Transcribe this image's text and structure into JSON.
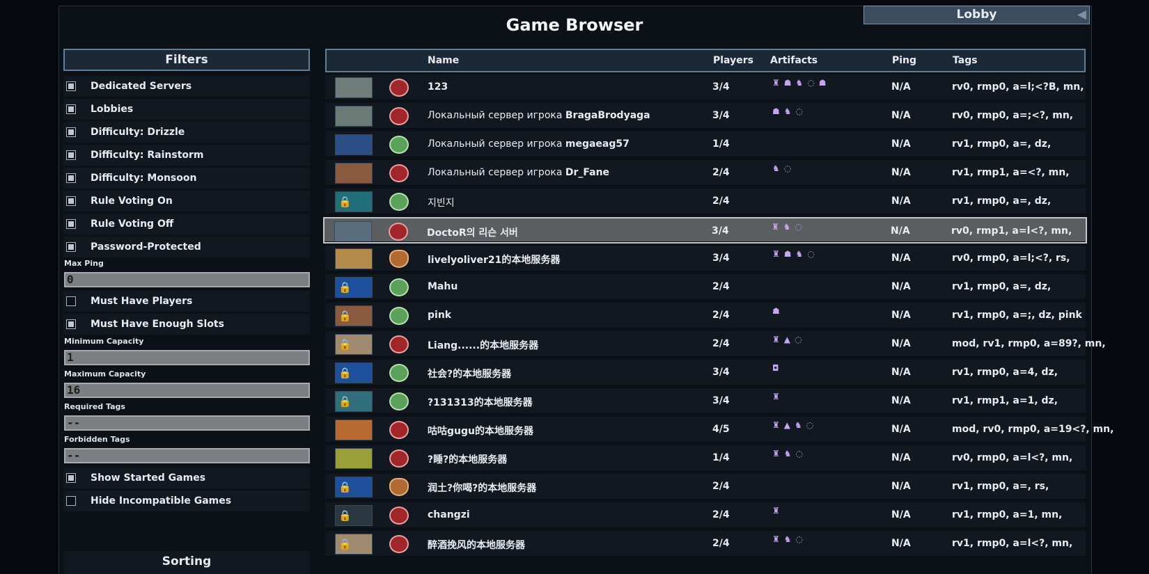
{
  "window": {
    "title": "Game Browser",
    "lobby_label": "Lobby"
  },
  "filters": {
    "title": "Filters",
    "checks_top": [
      {
        "label": "Dedicated Servers",
        "checked": true
      },
      {
        "label": "Lobbies",
        "checked": true
      },
      {
        "label": "Difficulty: Drizzle",
        "checked": true
      },
      {
        "label": "Difficulty: Rainstorm",
        "checked": true
      },
      {
        "label": "Difficulty: Monsoon",
        "checked": true
      },
      {
        "label": "Rule Voting On",
        "checked": true
      },
      {
        "label": "Rule Voting Off",
        "checked": true
      },
      {
        "label": "Password-Protected",
        "checked": true
      }
    ],
    "max_ping_label": "Max Ping",
    "max_ping_value": "0",
    "must_have_players": {
      "label": "Must Have Players",
      "checked": false
    },
    "must_have_slots": {
      "label": "Must Have Enough Slots",
      "checked": true
    },
    "min_capacity_label": "Minimum Capacity",
    "min_capacity_value": "1",
    "max_capacity_label": "Maximum Capacity",
    "max_capacity_value": "16",
    "required_tags_label": "Required Tags",
    "required_tags_value": "--",
    "forbidden_tags_label": "Forbidden Tags",
    "forbidden_tags_value": "--",
    "show_started": {
      "label": "Show Started Games",
      "checked": true
    },
    "hide_incompatible": {
      "label": "Hide Incompatible Games",
      "checked": false
    },
    "sorting_title": "Sorting"
  },
  "table": {
    "columns": {
      "name": "Name",
      "players": "Players",
      "artifacts": "Artifacts",
      "ping": "Ping",
      "tags": "Tags"
    },
    "rows": [
      {
        "name_prefix": "",
        "name_bold": "123",
        "players": "3/4",
        "artifacts": "♜☗♞◌☗",
        "ping": "N/A",
        "tags": "rv0, rmp0, a=l;<?B, mn,",
        "avatar": "red",
        "thumb": "#6f7e7a",
        "lock": false,
        "selected": false
      },
      {
        "name_prefix": "Локальный сервер игрока ",
        "name_bold": "BragaBrodyaga",
        "players": "3/4",
        "artifacts": "☗♞◌",
        "ping": "N/A",
        "tags": "rv0, rmp0, a=;<?, mn,",
        "avatar": "red",
        "thumb": "#6a7a74",
        "lock": false,
        "selected": false
      },
      {
        "name_prefix": "Локальный сервер игрока ",
        "name_bold": "megaeag57",
        "players": "1/4",
        "artifacts": "",
        "ping": "N/A",
        "tags": "rv1, rmp0, a=, dz,",
        "avatar": "green",
        "thumb": "#2a4e86",
        "lock": false,
        "selected": false
      },
      {
        "name_prefix": "Локальный сервер игрока ",
        "name_bold": "Dr_Fane",
        "players": "2/4",
        "artifacts": "♞◌",
        "ping": "N/A",
        "tags": "rv1, rmp1, a=<?, mn,",
        "avatar": "red",
        "thumb": "#8a5a3e",
        "lock": false,
        "selected": false
      },
      {
        "name_prefix": "지빈지",
        "name_bold": "",
        "players": "2/4",
        "artifacts": "",
        "ping": "N/A",
        "tags": "rv1, rmp0, a=, dz,",
        "avatar": "green",
        "thumb": "#1f6e78",
        "lock": true,
        "selected": false
      },
      {
        "name_prefix": "",
        "name_bold": "DoctoR의 리슨 서버",
        "players": "3/4",
        "artifacts": "♜♞◌",
        "ping": "N/A",
        "tags": "rv0, rmp1, a=l<?, mn,",
        "avatar": "red",
        "thumb": "#5a6e80",
        "lock": false,
        "selected": true
      },
      {
        "name_prefix": "",
        "name_bold": "livelyoliver21的本地服务器",
        "players": "3/4",
        "artifacts": "♜☗♞◌",
        "ping": "N/A",
        "tags": "rv0, rmp0, a=l;<?, rs,",
        "avatar": "orange",
        "thumb": "#b48a4a",
        "lock": false,
        "selected": false
      },
      {
        "name_prefix": "",
        "name_bold": "Mahu",
        "players": "2/4",
        "artifacts": "",
        "ping": "N/A",
        "tags": "rv1, rmp0, a=, dz,",
        "avatar": "green",
        "thumb": "#1d4f9a",
        "lock": true,
        "selected": false
      },
      {
        "name_prefix": "",
        "name_bold": "pink",
        "players": "2/4",
        "artifacts": "☗",
        "ping": "N/A",
        "tags": "rv1, rmp0, a=;, dz, pink",
        "avatar": "green",
        "thumb": "#8a5a3e",
        "lock": true,
        "selected": false
      },
      {
        "name_prefix": "",
        "name_bold": "Liang......的本地服务器",
        "players": "2/4",
        "artifacts": "♜▲◌",
        "ping": "N/A",
        "tags": "mod, rv1, rmp0, a=89?, mn,",
        "avatar": "red",
        "thumb": "#a08a70",
        "lock": true,
        "selected": false
      },
      {
        "name_prefix": "",
        "name_bold": "社会?的本地服务器",
        "players": "3/4",
        "artifacts": "◘",
        "ping": "N/A",
        "tags": "rv1, rmp0, a=4, dz,",
        "avatar": "green",
        "thumb": "#1d4f9a",
        "lock": true,
        "selected": false
      },
      {
        "name_prefix": "",
        "name_bold": "?131313的本地服务器",
        "players": "3/4",
        "artifacts": "♜",
        "ping": "N/A",
        "tags": "rv1, rmp1, a=1, dz,",
        "avatar": "green",
        "thumb": "#2f6e7a",
        "lock": true,
        "selected": false
      },
      {
        "name_prefix": "",
        "name_bold": "咕咕gugu的本地服务器",
        "players": "4/5",
        "artifacts": "♜▲♞◌",
        "ping": "N/A",
        "tags": "mod, rv0, rmp0, a=19<?, mn,",
        "avatar": "red",
        "thumb": "#b86a30",
        "lock": false,
        "selected": false
      },
      {
        "name_prefix": "",
        "name_bold": "?睡?的本地服务器",
        "players": "1/4",
        "artifacts": "♜♞◌",
        "ping": "N/A",
        "tags": "rv0, rmp0, a=l<?, mn,",
        "avatar": "red",
        "thumb": "#9aa03a",
        "lock": false,
        "selected": false
      },
      {
        "name_prefix": "",
        "name_bold": "润土?你喝?的本地服务器",
        "players": "2/4",
        "artifacts": "",
        "ping": "N/A",
        "tags": "rv1, rmp0, a=, rs,",
        "avatar": "orange",
        "thumb": "#1d4f9a",
        "lock": true,
        "selected": false
      },
      {
        "name_prefix": "",
        "name_bold": "changzi",
        "players": "2/4",
        "artifacts": "♜",
        "ping": "N/A",
        "tags": "rv1, rmp0, a=1, mn,",
        "avatar": "red",
        "thumb": "#2a3640",
        "lock": true,
        "selected": false
      },
      {
        "name_prefix": "",
        "name_bold": "醉酒挽风的本地服务器",
        "players": "2/4",
        "artifacts": "♜♞◌",
        "ping": "N/A",
        "tags": "rv1, rmp0, a=l<?, mn,",
        "avatar": "red",
        "thumb": "#a08a70",
        "lock": true,
        "selected": false
      }
    ]
  },
  "colors": {
    "artifact": "#c7a4f0",
    "header_border": "#5e7f9c",
    "selected_row": "#5b5e61"
  },
  "icons": {
    "back": "arrow-left-icon",
    "lock": "lock-icon"
  }
}
